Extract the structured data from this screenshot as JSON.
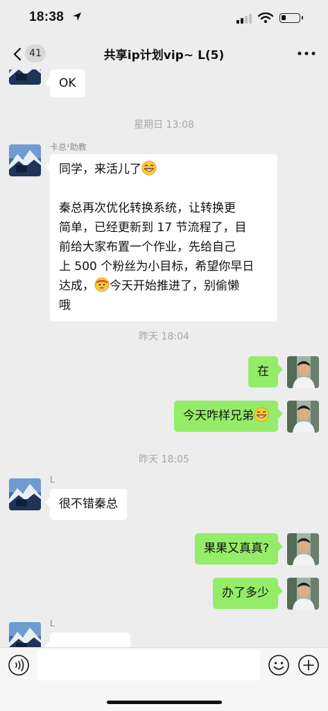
{
  "status_bar": {
    "time": "18:38"
  },
  "nav": {
    "unread_count": "41",
    "title": "共享ip计划vip~ L(5)"
  },
  "messages": {
    "m0": {
      "text": "OK"
    },
    "ts1": "星期日 13:08",
    "m1": {
      "sender": "卡总¹助教",
      "line1": "同学，来活儿了",
      "para2": [
        "秦总再次优化转换系统，让转换更",
        "简单，已经更新到 17 节流程了，目",
        "前给大家布置一个作业，先给自己",
        "上 500 个粉丝为小目标，希望你早日"
      ],
      "line_last_a": "达成，",
      "line_last_b": "今天开始推进了，别偷懒",
      "line_end": "哦"
    },
    "ts2": "昨天 18:04",
    "m2": {
      "text": "在"
    },
    "m3": {
      "text": "今天咋样兄弟"
    },
    "ts3": "昨天 18:05",
    "m4": {
      "sender": "L",
      "text": "很不错秦总"
    },
    "m5": {
      "text": "果果又真真?"
    },
    "m6": {
      "text": "办了多少"
    },
    "m7": {
      "sender": "L"
    }
  },
  "icons": {
    "back": "chevron-left-icon",
    "more": "more-dots-icon",
    "voice": "voice-icon",
    "emoji": "emoji-icon",
    "plus": "plus-icon"
  },
  "colors": {
    "background": "#ededed",
    "outgoing_bubble": "#95ec69",
    "incoming_bubble": "#ffffff"
  }
}
